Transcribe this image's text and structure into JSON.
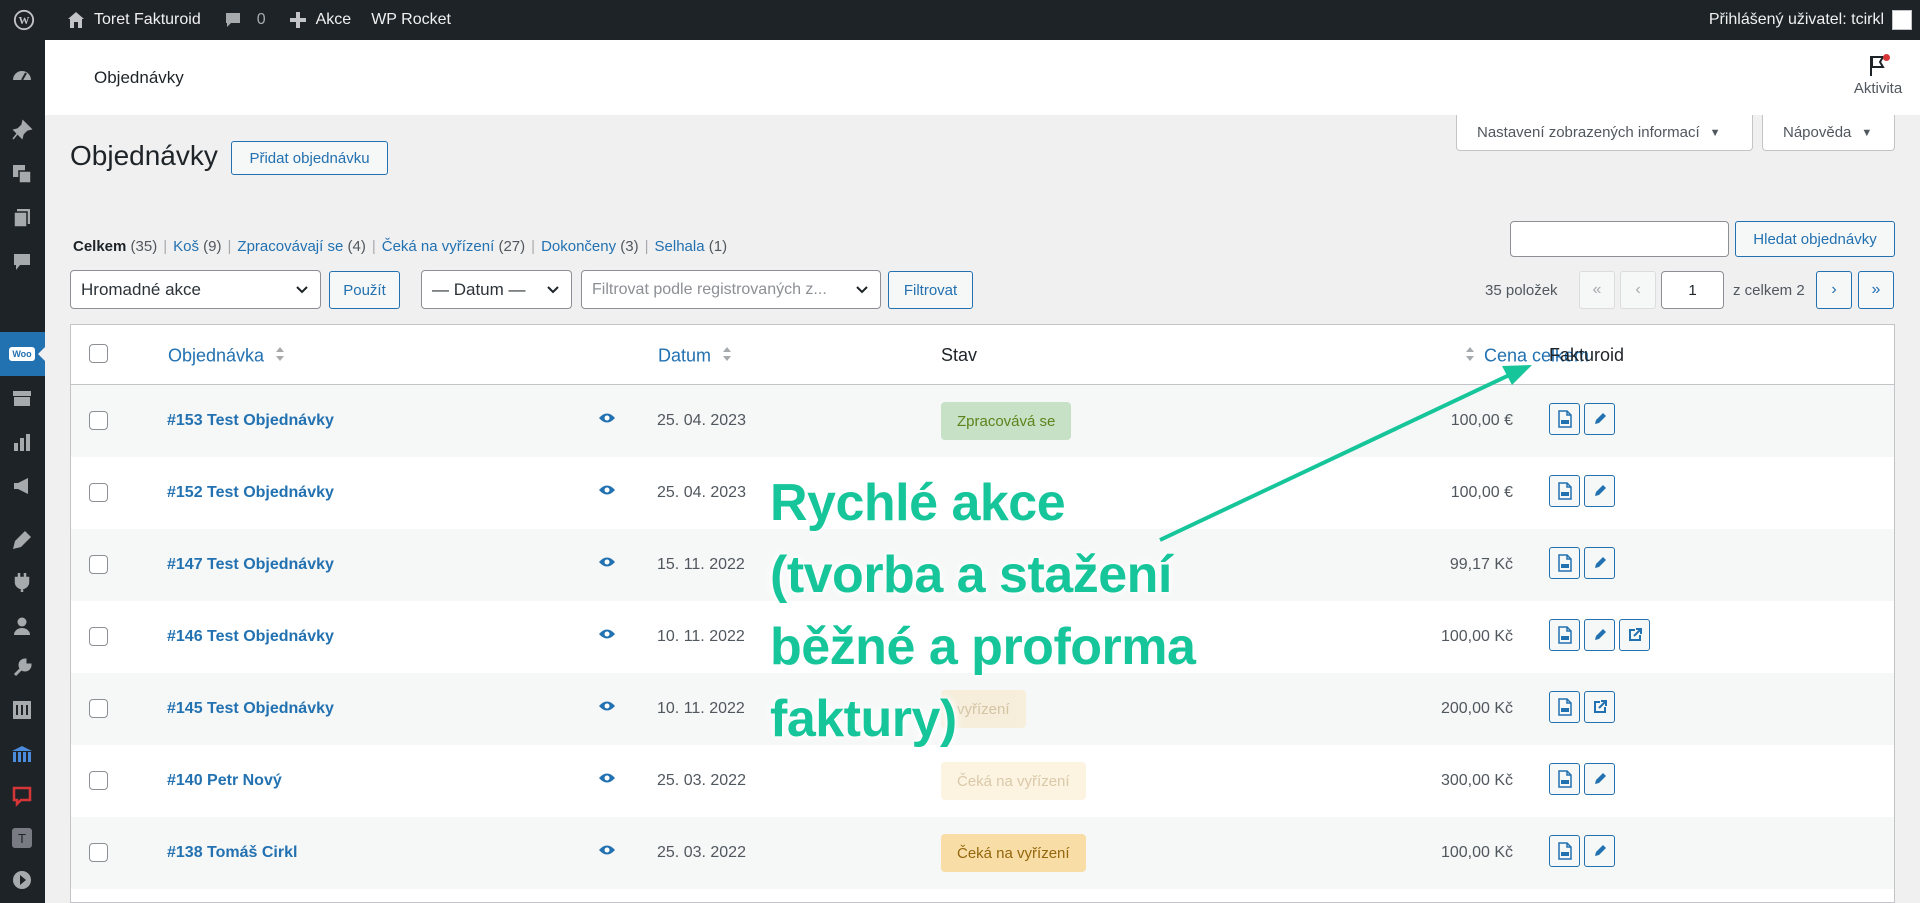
{
  "adminbar": {
    "site_name": "Toret Fakturoid",
    "comments_count": "0",
    "new_label": "Akce",
    "wp_rocket": "WP Rocket",
    "user_greeting": "Přihlášený uživatel: tcirkl"
  },
  "header": {
    "breadcrumb": "Objednávky",
    "activity_label": "Aktivita"
  },
  "screen_meta": {
    "options_label": "Nastavení zobrazených informací",
    "help_label": "Nápověda"
  },
  "page": {
    "title": "Objednávky",
    "add_button": "Přidat objednávku"
  },
  "views": [
    {
      "label": "Celkem",
      "count": "(35)"
    },
    {
      "label": "Koš",
      "count": "(9)"
    },
    {
      "label": "Zpracovávají se",
      "count": "(4)"
    },
    {
      "label": "Čeká na vyřízení",
      "count": "(27)"
    },
    {
      "label": "Dokončeny",
      "count": "(3)"
    },
    {
      "label": "Selhala",
      "count": "(1)"
    }
  ],
  "search": {
    "button": "Hledat objednávky",
    "value": ""
  },
  "filters": {
    "bulk_actions": "Hromadné akce",
    "apply": "Použít",
    "date": "— Datum —",
    "customer_placeholder": "Filtrovat podle registrovaných z...",
    "filter_button": "Filtrovat"
  },
  "pagination": {
    "items": "35 položek",
    "first": "«",
    "prev": "‹",
    "current_page": "1",
    "of_total": "z celkem 2",
    "next": "›",
    "last": "»"
  },
  "columns": {
    "order": "Objednávka",
    "date": "Datum",
    "status": "Stav",
    "total": "Cena celkem",
    "fakturoid": "Fakturoid"
  },
  "orders": [
    {
      "number": "#153 Test Objednávky",
      "date": "25. 04. 2023",
      "status": "Zpracovává se",
      "status_type": "processing",
      "total": "100,00 €",
      "actions": [
        "pdf-icon",
        "pencil-icon"
      ]
    },
    {
      "number": "#152 Test Objednávky",
      "date": "25. 04. 2023",
      "status": "",
      "status_type": "hidden",
      "total": "100,00 €",
      "actions": [
        "pdf-icon",
        "pencil-icon"
      ]
    },
    {
      "number": "#147 Test Objednávky",
      "date": "15. 11. 2022",
      "status": "",
      "status_type": "hidden",
      "total": "99,17 Kč",
      "actions": [
        "pdf-icon",
        "pencil-icon"
      ]
    },
    {
      "number": "#146 Test Objednávky",
      "date": "10. 11. 2022",
      "status": "",
      "status_type": "hidden",
      "total": "100,00 Kč",
      "actions": [
        "pdf-icon",
        "pencil-icon",
        "external-link-icon"
      ]
    },
    {
      "number": "#145 Test Objednávky",
      "date": "10. 11. 2022",
      "status": "vyřízení",
      "status_type": "faded",
      "total": "200,00 Kč",
      "actions": [
        "pdf-icon",
        "external-link-icon"
      ]
    },
    {
      "number": "#140 Petr Nový",
      "date": "25. 03. 2022",
      "status": "Čeká na vyřízení",
      "status_type": "faded",
      "total": "300,00 Kč",
      "actions": [
        "pdf-icon",
        "pencil-icon"
      ]
    },
    {
      "number": "#138 Tomáš Cirkl",
      "date": "25. 03. 2022",
      "status": "Čeká na vyřízení",
      "status_type": "onhold",
      "total": "100,00 Kč",
      "actions": [
        "pdf-icon",
        "pencil-icon"
      ]
    }
  ],
  "annotation": {
    "lines": [
      "Rychlé akce",
      "(tvorba a stažení",
      "běžné a proforma",
      "faktury)"
    ],
    "color": "#17c59a"
  },
  "colors": {
    "accent": "#2271b1",
    "adminbar": "#1d2327",
    "processing_bg": "#c6e1c6",
    "onhold_bg": "#f8dda7"
  }
}
